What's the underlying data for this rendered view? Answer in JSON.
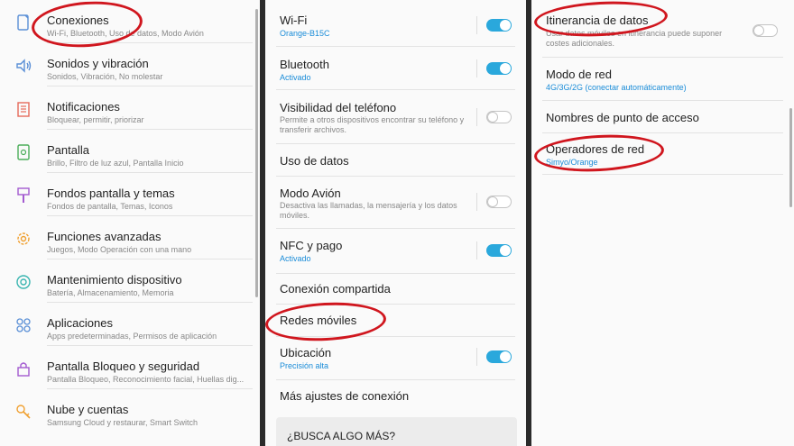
{
  "settings_menu": {
    "items": [
      {
        "title": "Conexiones",
        "subtitle": "Wi-Fi, Bluetooth, Uso de datos, Modo Avión",
        "icon": "connections-icon"
      },
      {
        "title": "Sonidos y vibración",
        "subtitle": "Sonidos, Vibración, No molestar",
        "icon": "sound-icon"
      },
      {
        "title": "Notificaciones",
        "subtitle": "Bloquear, permitir, priorizar",
        "icon": "notifications-icon"
      },
      {
        "title": "Pantalla",
        "subtitle": "Brillo, Filtro de luz azul, Pantalla Inicio",
        "icon": "display-icon"
      },
      {
        "title": "Fondos pantalla y temas",
        "subtitle": "Fondos de pantalla, Temas, Iconos",
        "icon": "brush-icon"
      },
      {
        "title": "Funciones avanzadas",
        "subtitle": "Juegos, Modo Operación con una mano",
        "icon": "gear-icon"
      },
      {
        "title": "Mantenimiento dispositivo",
        "subtitle": "Batería, Almacenamiento, Memoria",
        "icon": "maintenance-icon"
      },
      {
        "title": "Aplicaciones",
        "subtitle": "Apps predeterminadas, Permisos de aplicación",
        "icon": "apps-icon"
      },
      {
        "title": "Pantalla Bloqueo y seguridad",
        "subtitle": "Pantalla Bloqueo, Reconocimiento facial, Huellas dig...",
        "icon": "lock-icon"
      },
      {
        "title": "Nube y cuentas",
        "subtitle": "Samsung Cloud y restaurar, Smart Switch",
        "icon": "key-icon"
      }
    ]
  },
  "connections": {
    "items": [
      {
        "title": "Wi-Fi",
        "subtitle": "Orange-B15C",
        "toggle": true
      },
      {
        "title": "Bluetooth",
        "subtitle": "Activado",
        "toggle": true
      },
      {
        "title": "Visibilidad del teléfono",
        "subtitle": "Permite a otros dispositivos encontrar su teléfono y transferir archivos.",
        "toggle": false
      },
      {
        "title": "Uso de datos"
      },
      {
        "title": "Modo Avión",
        "subtitle": "Desactiva las llamadas, la mensajería y los datos móviles.",
        "toggle": false
      },
      {
        "title": "NFC y pago",
        "subtitle": "Activado",
        "toggle": true
      },
      {
        "title": "Conexión compartida"
      },
      {
        "title": "Redes móviles"
      },
      {
        "title": "Ubicación",
        "subtitle": "Precisión alta",
        "toggle": true
      },
      {
        "title": "Más ajustes de conexión"
      }
    ],
    "search_card": {
      "title": "¿BUSCA ALGO MÁS?"
    }
  },
  "mobile_networks": {
    "items": [
      {
        "title": "Itinerancia de datos",
        "subtitle": "Usar datos móviles en itinerancia puede suponer costes adicionales.",
        "toggle": false
      },
      {
        "title": "Modo de red",
        "subtitle": "4G/3G/2G (conectar automáticamente)"
      },
      {
        "title": "Nombres de punto de acceso"
      },
      {
        "title": "Operadores de red",
        "subtitle": "Simyo/Orange"
      }
    ]
  },
  "colors": {
    "accent": "#2aa8dc",
    "link": "#1a8cd8",
    "annotation": "#d0161e"
  }
}
